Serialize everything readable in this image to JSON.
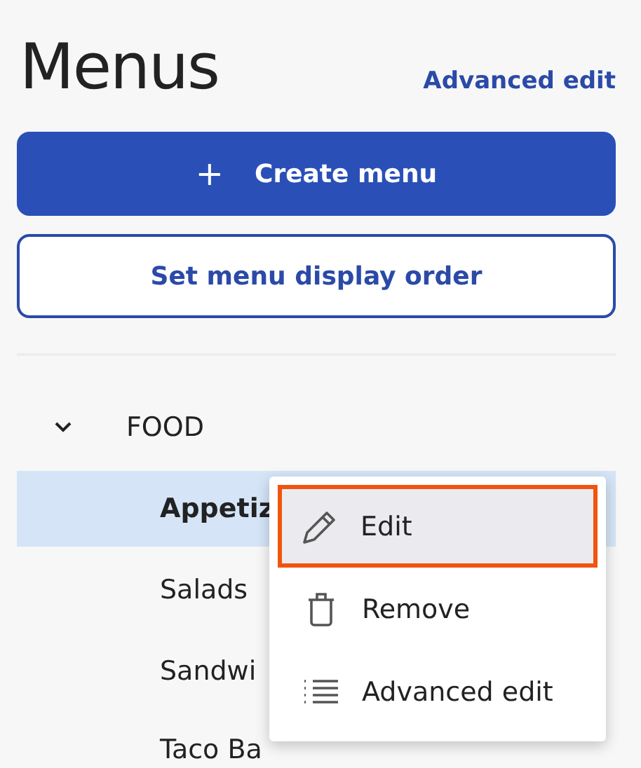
{
  "title": "Menus",
  "header_link": "Advanced edit",
  "create_button": {
    "icon": "+",
    "label": "Create menu"
  },
  "order_button": "Set menu display order",
  "tree": [
    {
      "label": "FOOD",
      "expanded": true,
      "children": [
        {
          "label": "Appetiz",
          "selected": true
        },
        {
          "label": "Salads",
          "selected": false
        },
        {
          "label": "Sandwi",
          "selected": false
        },
        {
          "label": "Taco Ba",
          "selected": false
        }
      ]
    }
  ],
  "context_menu": [
    {
      "kind": "edit",
      "label": "Edit",
      "selected": true
    },
    {
      "kind": "remove",
      "label": "Remove",
      "selected": false
    },
    {
      "kind": "list",
      "label": "Advanced edit",
      "selected": false
    }
  ]
}
